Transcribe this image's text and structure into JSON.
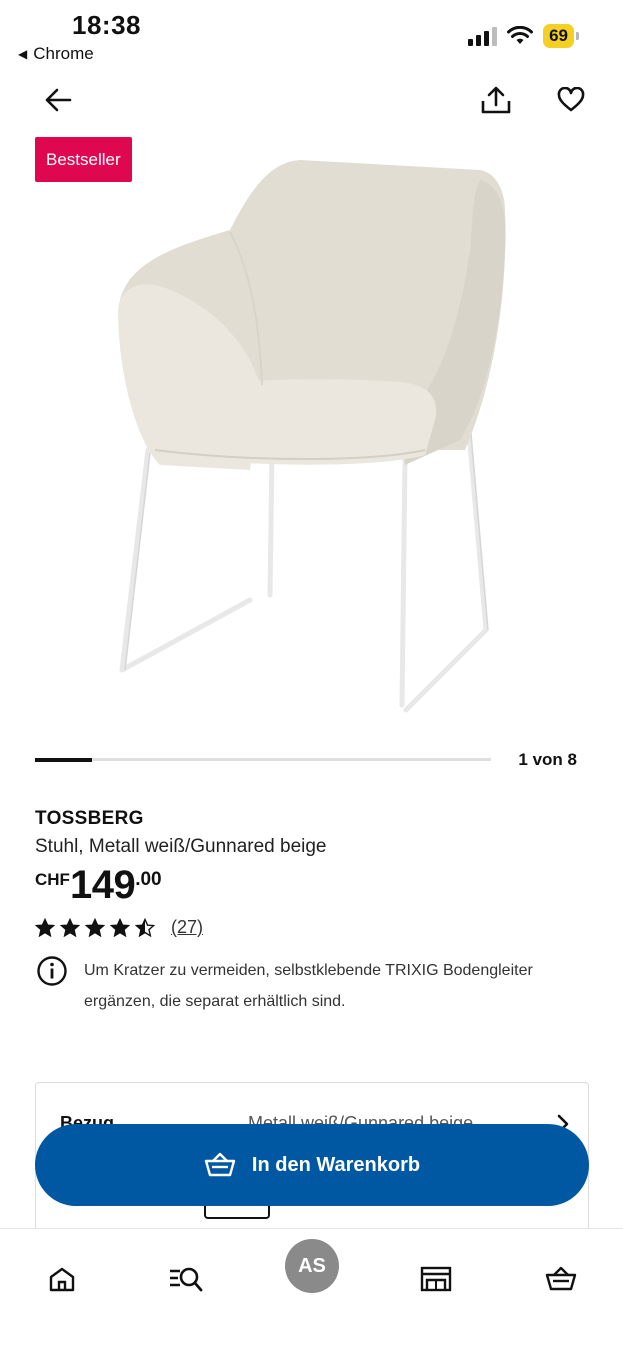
{
  "status_bar": {
    "time": "18:38",
    "back_app": "Chrome",
    "battery": "69"
  },
  "colors": {
    "badge": "#e00751",
    "primary_button": "#0058a3",
    "battery": "#f4cf24"
  },
  "toolbar": {
    "back_icon": "arrow-left-icon",
    "share_icon": "share-icon",
    "favorite_icon": "heart-icon"
  },
  "badge": "Bestseller",
  "carousel": {
    "counter": "1 von 8",
    "current": 1,
    "total": 8
  },
  "product": {
    "name": "TOSSBERG",
    "description": "Stuhl, Metall weiß/Gunnared beige",
    "currency": "CHF",
    "price_main": "149",
    "price_decimals": ".00",
    "rating": 4.5,
    "rating_max": 5,
    "reviews": "(27)"
  },
  "info": {
    "icon": "info-icon",
    "text": "Um Kratzer zu vermeiden, selbstklebende TRIXIG Bodengleiter ergänzen, die separat erhältlich sind."
  },
  "options": {
    "label": "Bezug",
    "value": "Metall weiß/Gunnared beige"
  },
  "cart_button": {
    "label": "In den Warenkorb",
    "icon": "basket-icon"
  },
  "bottom_nav": {
    "items": [
      {
        "icon": "home-icon"
      },
      {
        "icon": "search-list-icon"
      },
      {
        "label": "AS"
      },
      {
        "icon": "store-icon"
      },
      {
        "icon": "basket-icon"
      }
    ]
  }
}
